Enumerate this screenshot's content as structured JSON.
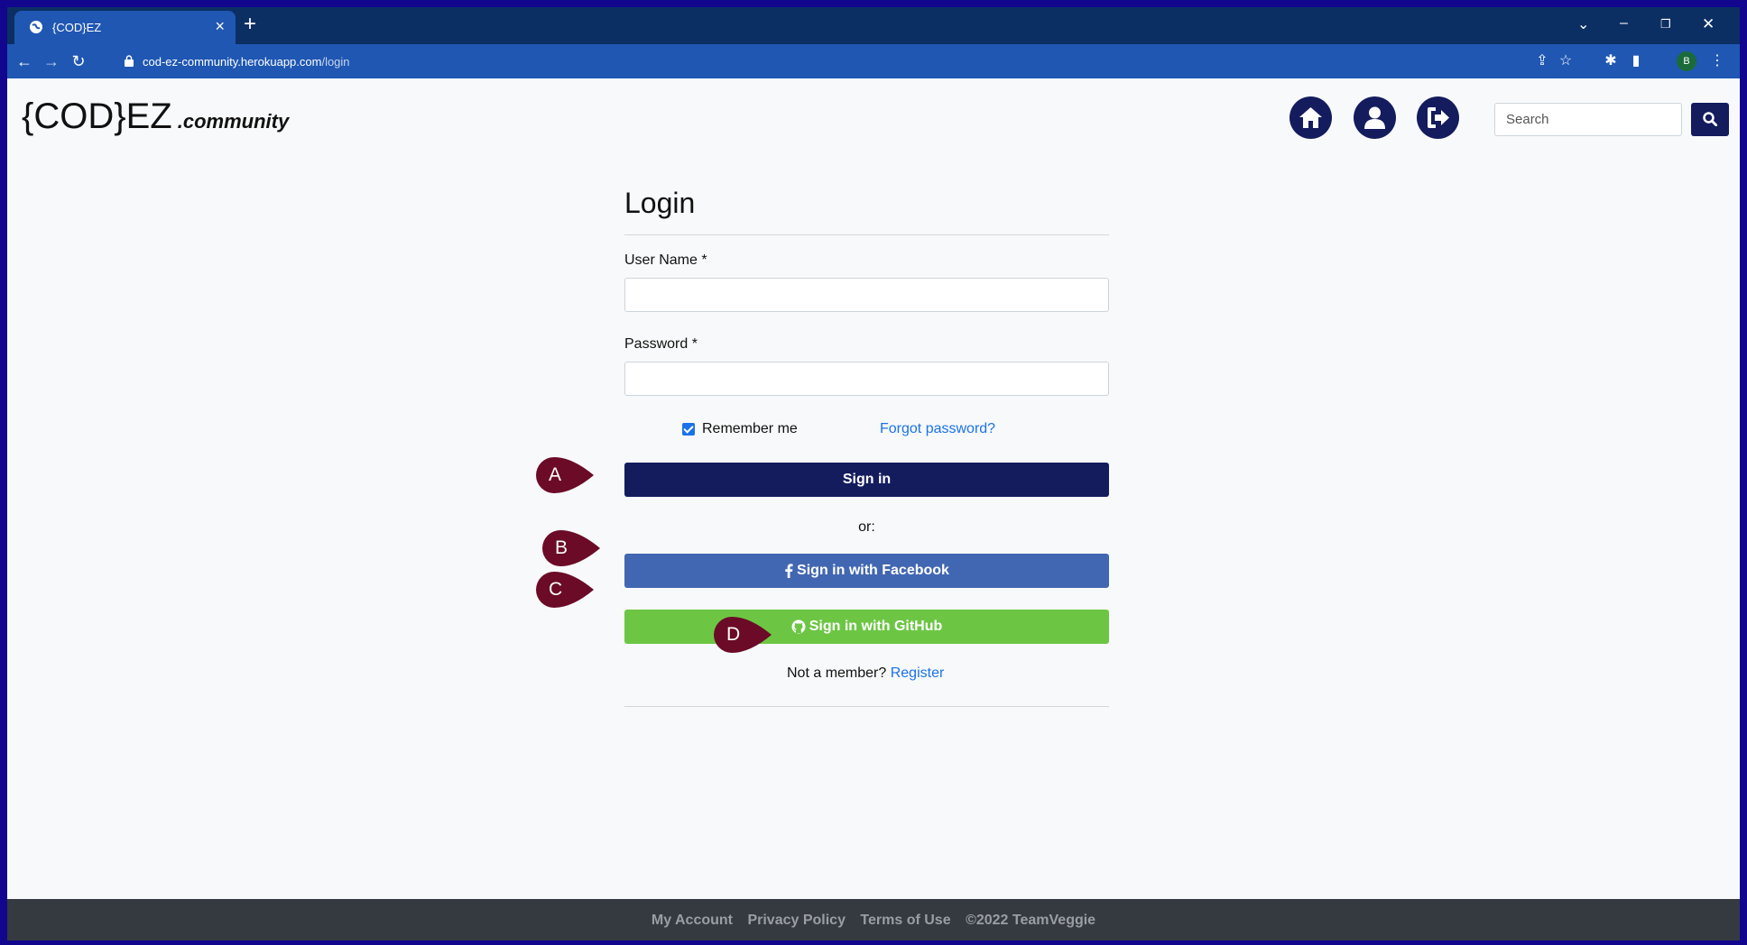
{
  "browser": {
    "tab_title": "{COD}EZ",
    "url_host": "cod-ez-community.herokuapp.com",
    "url_path": "/login",
    "profile_initial": "B"
  },
  "site": {
    "brand_main": "{COD}EZ",
    "brand_sub": ".community",
    "search_placeholder": "Search",
    "accent_color": "#141c5e"
  },
  "login": {
    "title": "Login",
    "username_label": "User Name *",
    "password_label": "Password *",
    "remember_label": "Remember me",
    "remember_checked": true,
    "forgot_link": "Forgot password?",
    "signin_button": "Sign in",
    "or_text": "or:",
    "facebook_button": "Sign in with Facebook",
    "github_button": "Sign in with GitHub",
    "not_member_text": "Not a member?",
    "register_link": "Register"
  },
  "markers": [
    "A",
    "B",
    "C",
    "D"
  ],
  "footer": {
    "links": [
      "My Account",
      "Privacy Policy",
      "Terms of Use"
    ],
    "copyright": "©2022 TeamVeggie"
  }
}
